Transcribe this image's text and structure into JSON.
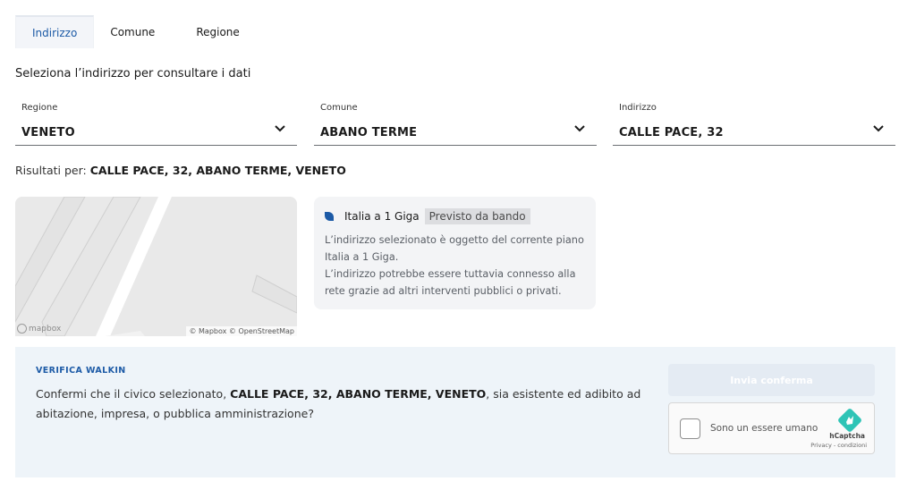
{
  "tabs": [
    {
      "label": "Indirizzo",
      "active": true
    },
    {
      "label": "Comune",
      "active": false
    },
    {
      "label": "Regione",
      "active": false
    }
  ],
  "subtitle": "Seleziona l’indirizzo per consultare i dati",
  "selects": [
    {
      "label": "Regione",
      "value": "VENETO"
    },
    {
      "label": "Comune",
      "value": "ABANO TERME"
    },
    {
      "label": "Indirizzo",
      "value": "CALLE PACE, 32"
    }
  ],
  "results": {
    "prefix": "Risultati per:",
    "value": "CALLE PACE, 32, ABANO TERME, VENETO"
  },
  "map": {
    "logo": "mapbox",
    "attribution": "© Mapbox © OpenStreetMap"
  },
  "info_card": {
    "name": "Italia a 1 Giga",
    "badge": "Previsto da bando",
    "description_1": "L’indirizzo selezionato è oggetto del corrente piano Italia a 1 Giga.",
    "description_2": "L’indirizzo potrebbe essere tuttavia connesso alla rete grazie ad altri interventi pubblici o privati."
  },
  "verifica": {
    "title": "VERIFICA WALKIN",
    "question_before": "Confermi che il civico selezionato, ",
    "question_address": "CALLE PACE, 32, ABANO TERME, VENETO",
    "question_after": ", sia esistente ed adibito ad abitazione, impresa, o pubblica amministrazione?",
    "submit_label": "Invia conferma"
  },
  "captcha": {
    "label": "Sono un essere umano",
    "brand": "hCaptcha",
    "privacy": "Privacy - condizioni"
  },
  "colors": {
    "accent": "#1c5aa6",
    "panel_bg": "#eef4f9",
    "card_bg": "#f3f4f6",
    "captcha_logo": "#2ec4b6"
  }
}
